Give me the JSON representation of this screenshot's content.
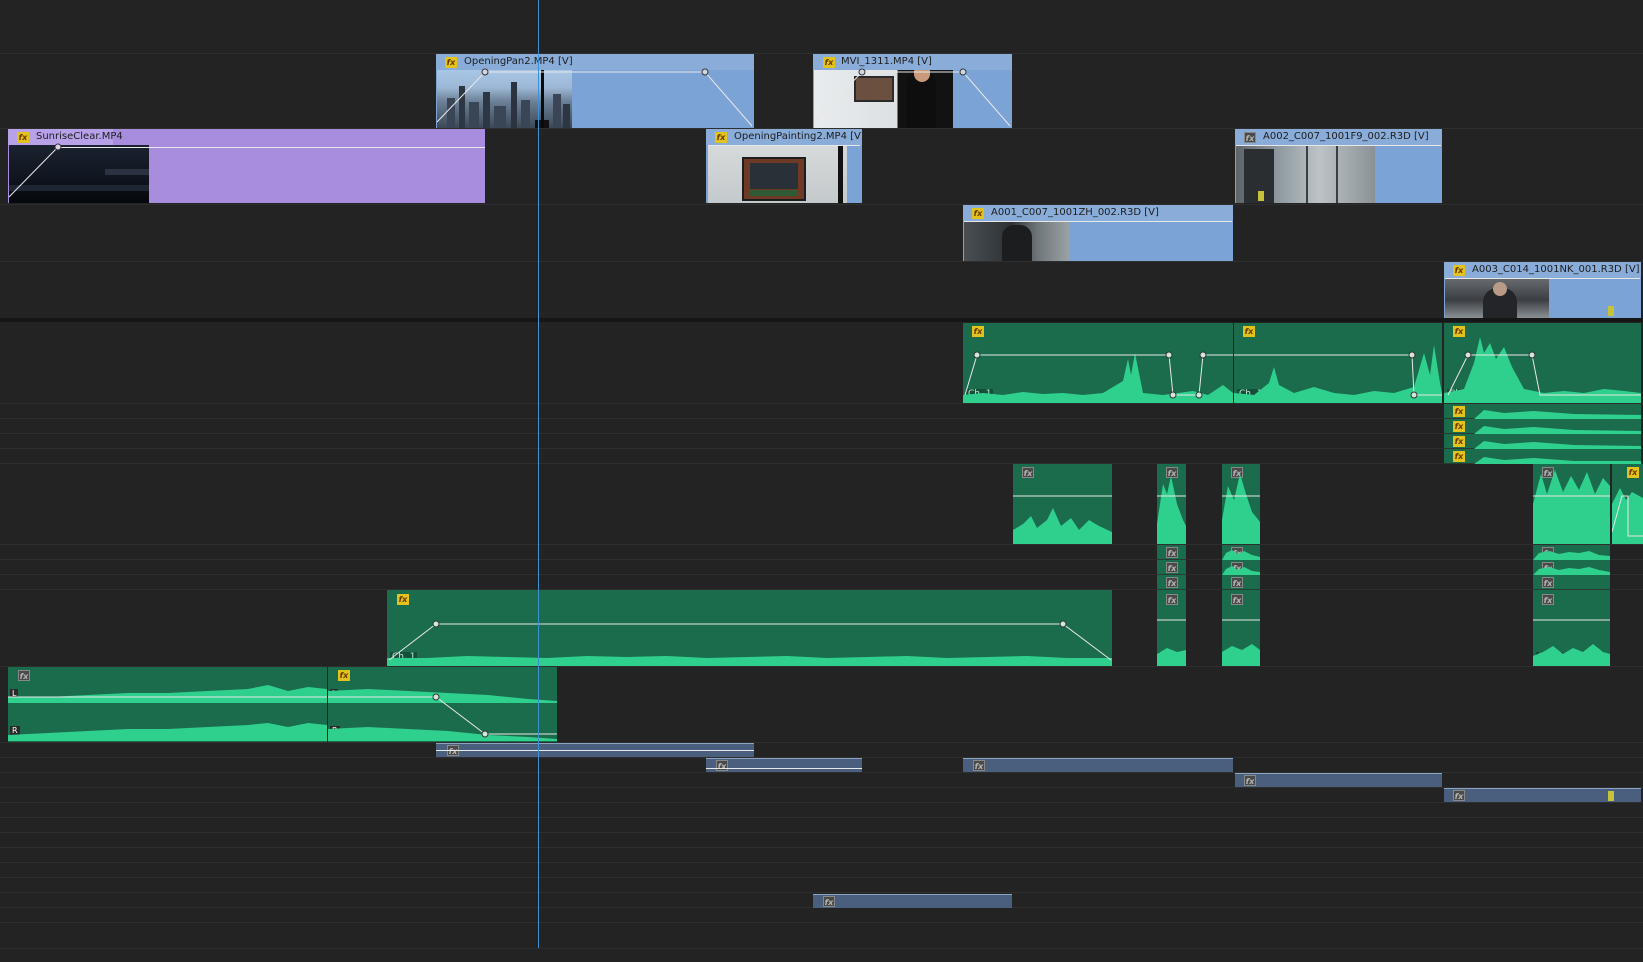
{
  "timeline": {
    "colors": {
      "background": "#232323",
      "video_clip": "#7ba3d6",
      "video_clip_purple": "#a88ddf",
      "audio_clip": "#1b6b4d",
      "audio_waveform": "#2fd08e",
      "subclip": "#4a5f7d",
      "playhead": "#3d8fd6",
      "fx_active": "#e3c21b"
    },
    "video_clips": [
      {
        "name": "OpeningPan2.MP4 [V]",
        "fx": "fx",
        "icon": "fx-badge-icon"
      },
      {
        "name": "MVI_1311.MP4 [V]",
        "fx": "fx",
        "icon": "fx-badge-icon"
      },
      {
        "name": "SunriseClear.MP4",
        "fx": "fx",
        "icon": "fx-badge-icon"
      },
      {
        "name": "OpeningPainting2.MP4 [V]",
        "fx": "fx",
        "icon": "fx-badge-icon"
      },
      {
        "name": "A002_C007_1001F9_002.R3D [V]",
        "fx": "fx",
        "icon": "fx-badge-icon"
      },
      {
        "name": "A001_C007_1001ZH_002.R3D [V]",
        "fx": "fx",
        "icon": "fx-badge-icon"
      },
      {
        "name": "A003_C014_1001NK_001.R3D [V]",
        "fx": "fx",
        "icon": "fx-badge-icon"
      }
    ],
    "audio_labels": {
      "ch1": "Ch. 1",
      "ch5": "Ch. 5",
      "left": "L",
      "right": "R",
      "fx": "fx"
    }
  }
}
